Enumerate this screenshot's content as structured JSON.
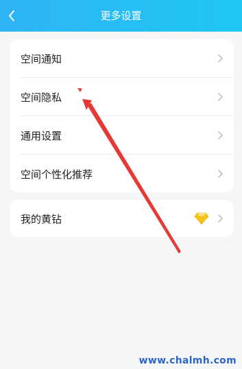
{
  "header": {
    "title": "更多设置"
  },
  "menu": {
    "items": [
      {
        "label": "空间通知"
      },
      {
        "label": "空间隐私"
      },
      {
        "label": "通用设置"
      },
      {
        "label": "空间个性化推荐"
      }
    ]
  },
  "diamond_section": {
    "label": "我的黄钻"
  },
  "icons": {
    "back": "chevron-left-icon",
    "chevron": "chevron-right-icon",
    "diamond": "yellow-diamond-icon"
  },
  "colors": {
    "header_start": "#2fb4f5",
    "header_end": "#1ec7f3",
    "page_background": "#f5f6f8",
    "card_background": "#ffffff",
    "diamond": "#f8c81c",
    "annotation_arrow": "#e53935",
    "watermark": "#2b66c8"
  },
  "watermark": "www.chalmh.com"
}
